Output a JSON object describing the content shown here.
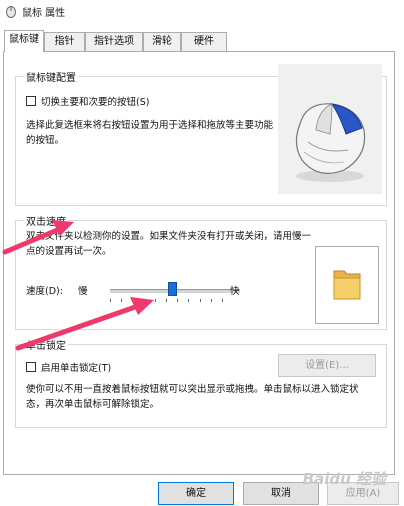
{
  "window": {
    "title": "鼠标 属性"
  },
  "tabs": [
    {
      "label": "鼠标键",
      "active": true
    },
    {
      "label": "指针",
      "active": false
    },
    {
      "label": "指针选项",
      "active": false
    },
    {
      "label": "滑轮",
      "active": false
    },
    {
      "label": "硬件",
      "active": false
    }
  ],
  "button_config": {
    "title": "鼠标键配置",
    "checkbox_label": "切换主要和次要的按钮(S)",
    "checkbox_checked": false,
    "description": "选择此复选框来将右按钮设置为用于选择和拖放等主要功能的按钮。"
  },
  "double_click": {
    "title": "双击速度",
    "description": "双击文件夹以检测你的设置。如果文件夹没有打开或关闭，请用慢一点的设置再试一次。",
    "speed_label": "速度(D):",
    "slow_label": "慢",
    "fast_label": "快",
    "speed_position": 0.55
  },
  "click_lock": {
    "title": "单击锁定",
    "checkbox_label": "启用单击锁定(T)",
    "checkbox_checked": false,
    "settings_button": "设置(E)...",
    "description": "使你可以不用一直按着鼠标按钮就可以突出显示或拖拽。单击鼠标以进入锁定状态，再次单击鼠标可解除锁定。"
  },
  "footer": {
    "ok_label": "确定",
    "cancel_label": "取消",
    "apply_label": "应用(A)"
  },
  "colors": {
    "accent": "#1a6fd6",
    "arrow": "#f0386b"
  },
  "watermark": {
    "text": "Baidu 经验"
  }
}
